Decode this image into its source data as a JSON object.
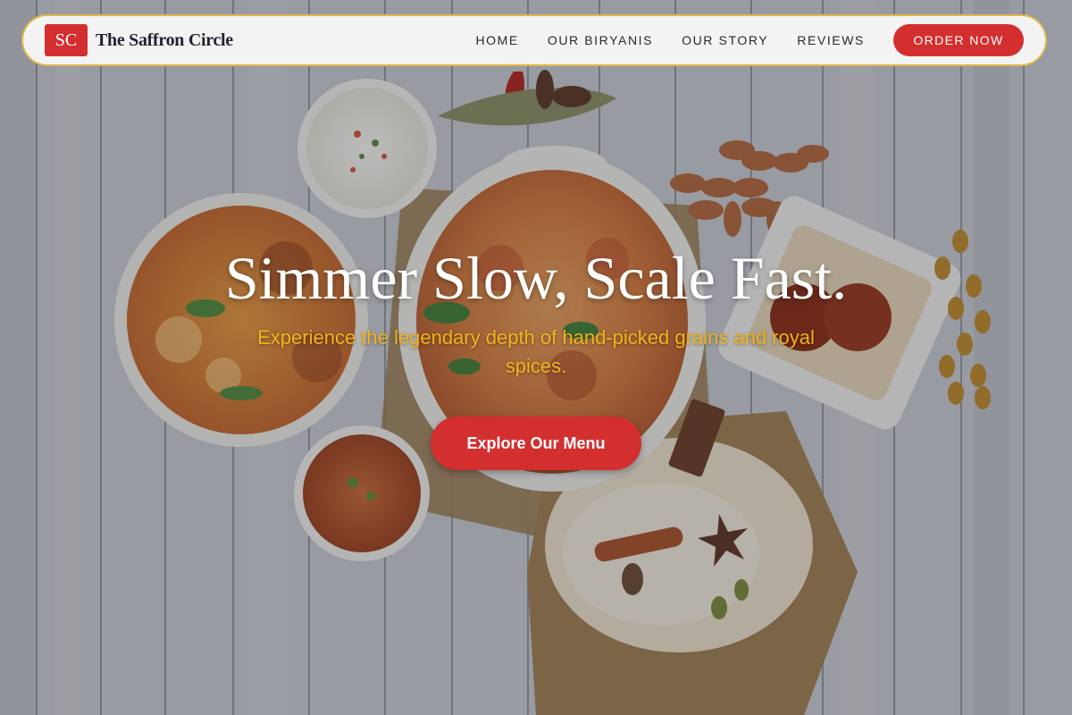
{
  "brand": {
    "logo_text": "SC",
    "name": "The Saffron Circle"
  },
  "nav": {
    "links": [
      "HOME",
      "OUR BIRYANIS",
      "OUR STORY",
      "REVIEWS"
    ],
    "order_label": "ORDER NOW"
  },
  "hero": {
    "title": "Simmer Slow, Scale Fast.",
    "subtitle": "Experience the legendary depth of hand-picked grains and royal spices.",
    "cta_label": "Explore Our Menu"
  },
  "colors": {
    "accent": "#d32f2f",
    "subtitle": "#f2b21a",
    "nav_border": "#e0b84a"
  }
}
